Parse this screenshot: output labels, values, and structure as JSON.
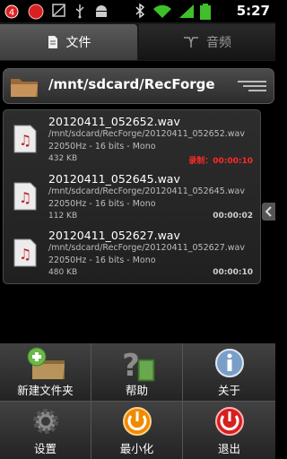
{
  "status_bar": {
    "time": "5:27",
    "notification_badge": "4",
    "icons": [
      "notification-badge-icon",
      "record-dot-icon",
      "image-icon",
      "usb-icon",
      "android-debug-icon",
      "bluetooth-icon",
      "wifi-icon",
      "signal-icon",
      "battery-icon"
    ]
  },
  "tabs": [
    {
      "label": "文件",
      "icon": "document-icon",
      "selected": true
    },
    {
      "label": "音频",
      "icon": "audio-icon",
      "selected": false
    }
  ],
  "path_bar": {
    "path": "/mnt/sdcard/RecForge",
    "icon": "folder-icon"
  },
  "files": [
    {
      "name": "20120411_052652.wav",
      "path": "/mnt/sdcard/RecForge/20120411_052652.wav",
      "format": "22050Hz - 16 bits - Mono",
      "size": "432 KB",
      "recording_label": "录制：00:00:10",
      "duration": ""
    },
    {
      "name": "20120411_052645.wav",
      "path": "/mnt/sdcard/RecForge/20120411_052645.wav",
      "format": "22050Hz - 16 bits - Mono",
      "size": "112 KB",
      "recording_label": "",
      "duration": "00:00:02"
    },
    {
      "name": "20120411_052627.wav",
      "path": "/mnt/sdcard/RecForge/20120411_052627.wav",
      "format": "22050Hz - 16 bits - Mono",
      "size": "480 KB",
      "recording_label": "",
      "duration": "00:00:10"
    }
  ],
  "menu": [
    {
      "label": "新建文件夹",
      "icon": "new-folder-icon"
    },
    {
      "label": "帮助",
      "icon": "help-icon"
    },
    {
      "label": "关于",
      "icon": "info-icon"
    },
    {
      "label": "设置",
      "icon": "settings-icon"
    },
    {
      "label": "最小化",
      "icon": "minimize-icon"
    },
    {
      "label": "退出",
      "icon": "exit-icon"
    }
  ],
  "colors": {
    "accent_red": "#ff2a2a",
    "accent_orange": "#f08a00",
    "menu_bg": "#2a2a2a"
  }
}
